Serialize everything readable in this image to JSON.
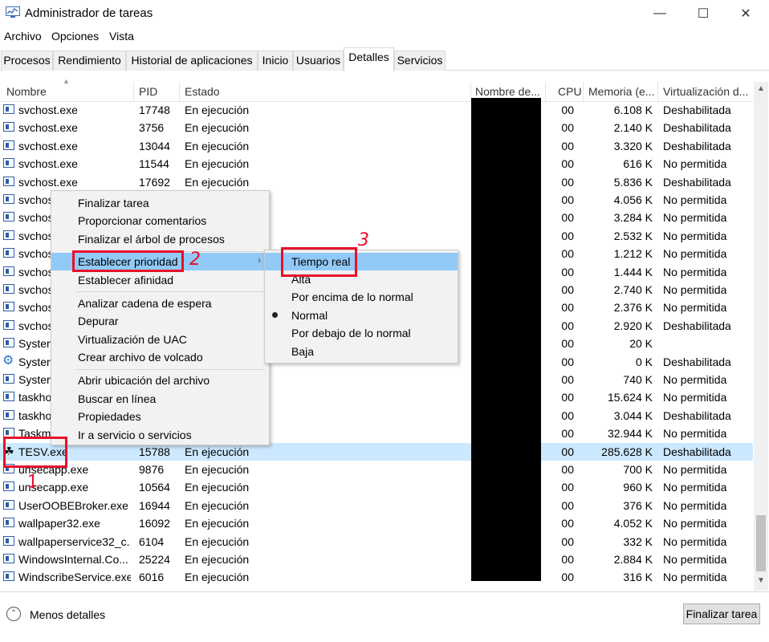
{
  "window": {
    "title": "Administrador de tareas"
  },
  "menubar": [
    "Archivo",
    "Opciones",
    "Vista"
  ],
  "tabs": [
    "Procesos",
    "Rendimiento",
    "Historial de aplicaciones",
    "Inicio",
    "Usuarios",
    "Detalles",
    "Servicios"
  ],
  "active_tab": "Detalles",
  "columns": [
    "Nombre",
    "PID",
    "Estado",
    "Nombre de...",
    "CPU",
    "Memoria (e...",
    "Virtualización d..."
  ],
  "rows": [
    {
      "name": "svchost.exe",
      "pid": "17748",
      "state": "En ejecución",
      "cpu": "00",
      "mem": "6.108 K",
      "virt": "Deshabilitada",
      "icon": "process-icon"
    },
    {
      "name": "svchost.exe",
      "pid": "3756",
      "state": "En ejecución",
      "cpu": "00",
      "mem": "2.140 K",
      "virt": "Deshabilitada",
      "icon": "process-icon"
    },
    {
      "name": "svchost.exe",
      "pid": "13044",
      "state": "En ejecución",
      "cpu": "00",
      "mem": "3.320 K",
      "virt": "Deshabilitada",
      "icon": "process-icon"
    },
    {
      "name": "svchost.exe",
      "pid": "11544",
      "state": "En ejecución",
      "cpu": "00",
      "mem": "616 K",
      "virt": "No permitida",
      "icon": "process-icon"
    },
    {
      "name": "svchost.exe",
      "pid": "17692",
      "state": "En ejecución",
      "cpu": "00",
      "mem": "5.836 K",
      "virt": "Deshabilitada",
      "icon": "process-icon"
    },
    {
      "name": "svchost",
      "pid": "",
      "state": "",
      "cpu": "00",
      "mem": "4.056 K",
      "virt": "No permitida",
      "icon": "process-icon"
    },
    {
      "name": "svchost",
      "pid": "",
      "state": "",
      "cpu": "00",
      "mem": "3.284 K",
      "virt": "No permitida",
      "icon": "process-icon"
    },
    {
      "name": "svchost",
      "pid": "",
      "state": "",
      "cpu": "00",
      "mem": "2.532 K",
      "virt": "No permitida",
      "icon": "process-icon"
    },
    {
      "name": "svchost",
      "pid": "",
      "state": "",
      "cpu": "00",
      "mem": "1.212 K",
      "virt": "No permitida",
      "icon": "process-icon"
    },
    {
      "name": "svchost",
      "pid": "",
      "state": "",
      "cpu": "00",
      "mem": "1.444 K",
      "virt": "No permitida",
      "icon": "process-icon"
    },
    {
      "name": "svchost",
      "pid": "",
      "state": "",
      "cpu": "00",
      "mem": "2.740 K",
      "virt": "No permitida",
      "icon": "process-icon"
    },
    {
      "name": "svchost",
      "pid": "",
      "state": "",
      "cpu": "00",
      "mem": "2.376 K",
      "virt": "No permitida",
      "icon": "process-icon"
    },
    {
      "name": "svchost",
      "pid": "",
      "state": "",
      "cpu": "00",
      "mem": "2.920 K",
      "virt": "Deshabilitada",
      "icon": "process-icon"
    },
    {
      "name": "System",
      "pid": "",
      "state": "",
      "cpu": "00",
      "mem": "20 K",
      "virt": "",
      "icon": "process-icon"
    },
    {
      "name": "System",
      "pid": "",
      "state": "",
      "cpu": "00",
      "mem": "0 K",
      "virt": "Deshabilitada",
      "icon": "gear-icon"
    },
    {
      "name": "System",
      "pid": "",
      "state": "",
      "cpu": "00",
      "mem": "740 K",
      "virt": "No permitida",
      "icon": "process-icon"
    },
    {
      "name": "taskho",
      "pid": "",
      "state": "",
      "cpu": "00",
      "mem": "15.624 K",
      "virt": "No permitida",
      "icon": "process-icon"
    },
    {
      "name": "taskho",
      "pid": "",
      "state": "",
      "cpu": "00",
      "mem": "3.044 K",
      "virt": "Deshabilitada",
      "icon": "process-icon"
    },
    {
      "name": "Taskm",
      "pid": "",
      "state": "",
      "cpu": "00",
      "mem": "32.944 K",
      "virt": "No permitida",
      "icon": "process-icon"
    },
    {
      "name": "TESV.exe",
      "pid": "15788",
      "state": "En ejecución",
      "cpu": "00",
      "mem": "285.628 K",
      "virt": "Deshabilitada",
      "icon": "tesv-icon"
    },
    {
      "name": "unsecapp.exe",
      "pid": "9876",
      "state": "En ejecución",
      "cpu": "00",
      "mem": "700 K",
      "virt": "No permitida",
      "icon": "process-icon"
    },
    {
      "name": "unsecapp.exe",
      "pid": "10564",
      "state": "En ejecución",
      "cpu": "00",
      "mem": "960 K",
      "virt": "No permitida",
      "icon": "process-icon"
    },
    {
      "name": "UserOOBEBroker.exe",
      "pid": "16944",
      "state": "En ejecución",
      "cpu": "00",
      "mem": "376 K",
      "virt": "No permitida",
      "icon": "process-icon"
    },
    {
      "name": "wallpaper32.exe",
      "pid": "16092",
      "state": "En ejecución",
      "cpu": "00",
      "mem": "4.052 K",
      "virt": "No permitida",
      "icon": "wallpaper-icon"
    },
    {
      "name": "wallpaperservice32_c...",
      "pid": "6104",
      "state": "En ejecución",
      "cpu": "00",
      "mem": "332 K",
      "virt": "No permitida",
      "icon": "process-icon"
    },
    {
      "name": "WindowsInternal.Co...",
      "pid": "25224",
      "state": "En ejecución",
      "cpu": "00",
      "mem": "2.884 K",
      "virt": "No permitida",
      "icon": "process-icon"
    },
    {
      "name": "WindscribeService.exe",
      "pid": "6016",
      "state": "En ejecución",
      "cpu": "00",
      "mem": "316 K",
      "virt": "No permitida",
      "icon": "process-icon"
    }
  ],
  "selected_row": "TESV.exe",
  "context_menu": {
    "items": [
      "Finalizar tarea",
      "Proporcionar comentarios",
      "Finalizar el árbol de procesos",
      "Establecer prioridad",
      "Establecer afinidad",
      "Analizar cadena de espera",
      "Depurar",
      "Virtualización de UAC",
      "Crear archivo de volcado",
      "Abrir ubicación del archivo",
      "Buscar en línea",
      "Propiedades",
      "Ir a servicio o servicios"
    ],
    "highlighted": "Establecer prioridad"
  },
  "priority_submenu": {
    "items": [
      "Tiempo real",
      "Alta",
      "Por encima de lo normal",
      "Normal",
      "Por debajo de lo normal",
      "Baja"
    ],
    "highlighted": "Tiempo real",
    "checked": "Normal"
  },
  "footer": {
    "less_details": "Menos detalles",
    "end_task": "Finalizar tarea"
  },
  "annotations": [
    "1",
    "2",
    "3"
  ],
  "colors": {
    "selection": "#cce8ff",
    "menu_hover": "#91c9f7",
    "annotation": "#e8102a",
    "icon_blue": "#2a5da8"
  }
}
